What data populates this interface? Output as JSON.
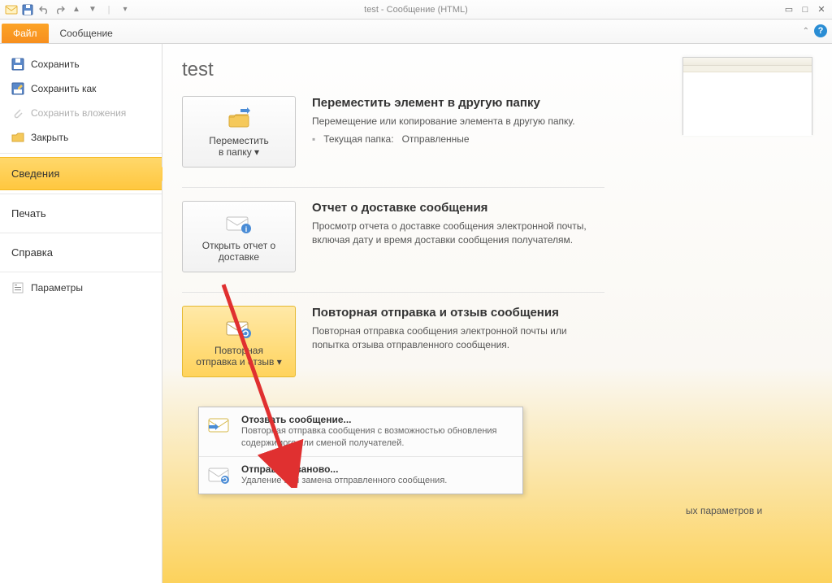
{
  "window": {
    "title": "test - Сообщение (HTML)"
  },
  "ribbon": {
    "file": "Файл",
    "message": "Сообщение"
  },
  "sidebar": {
    "save": "Сохранить",
    "save_as": "Сохранить как",
    "save_attachments": "Сохранить вложения",
    "close": "Закрыть",
    "info": "Сведения",
    "print": "Печать",
    "help": "Справка",
    "options": "Параметры"
  },
  "page": {
    "title": "test",
    "move": {
      "button": "Переместить\nв папку ▾",
      "heading": "Переместить элемент в другую папку",
      "desc": "Перемещение или копирование элемента в другую папку.",
      "current_label": "Текущая папка:",
      "current_value": "Отправленные"
    },
    "delivery": {
      "button": "Открыть отчет о\nдоставке",
      "heading": "Отчет о доставке сообщения",
      "desc": "Просмотр отчета о доставке сообщения электронной почты, включая дату и время доставки сообщения получателям."
    },
    "resend": {
      "button": "Повторная\nотправка и отзыв ▾",
      "heading": "Повторная отправка и отзыв сообщения",
      "desc": "Повторная отправка сообщения электронной почты или попытка отзыва отправленного сообщения."
    },
    "extra_fragment": "ых параметров и"
  },
  "dropdown": {
    "recall": {
      "title": "Отозвать сообщение...",
      "desc": "Повторная отправка сообщения с возможностью обновления содержимого или сменой получателей."
    },
    "resend": {
      "title": "Отправить заново...",
      "desc": "Удаление или замена отправленного сообщения."
    }
  }
}
